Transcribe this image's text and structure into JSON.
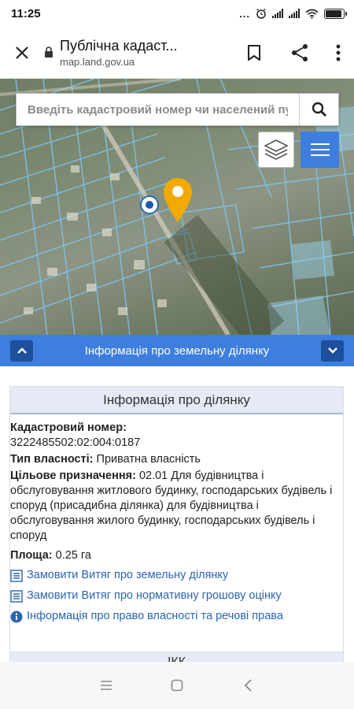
{
  "status_bar": {
    "time": "11:25",
    "dots": "...",
    "battery_level": 0.9
  },
  "browser": {
    "title": "Публічна кадаст...",
    "url": "map.land.gov.ua"
  },
  "map": {
    "search_placeholder": "Введіть кадастровий номер чи населений пун"
  },
  "panel": {
    "header_title": "Інформація про земельну ділянку",
    "card_title": "Інформація про ділянку",
    "cadastral_label": "Кадастровий номер:",
    "cadastral_value": "3222485502:02:004:0187",
    "ownership_label": "Тип власності:",
    "ownership_value": "Приватна власність",
    "purpose_label": "Цільове призначення:",
    "purpose_value": "02.01 Для будівництва і обслуговування житлового будинку, господарських будівель і споруд (присадибна ділянка) для будівництва і обслуговування жилого будинку, господарських будівель і споруд",
    "area_label": "Площа:",
    "area_value": "0.25 га",
    "links": [
      {
        "label": "Замовити Витяг про земельну ділянку"
      },
      {
        "label": "Замовити Витяг про нормативну грошову оцінку"
      },
      {
        "label": "Інформація про право власності та речові права"
      }
    ],
    "next_section_title": "ІКК"
  },
  "colors": {
    "accent": "#3d7ede",
    "link": "#2a64b0",
    "pin": "#f2a900"
  }
}
